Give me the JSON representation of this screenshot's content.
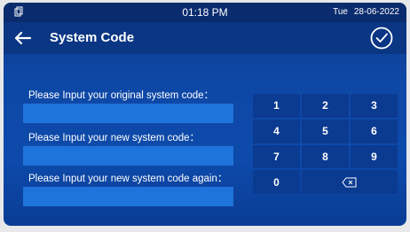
{
  "status": {
    "time": "01:18 PM",
    "day": "Tue",
    "date": "28-06-2022"
  },
  "header": {
    "title": "System Code"
  },
  "form": {
    "original_label": "Please Input your original system code：",
    "new_label": "Please Input your new system code：",
    "confirm_label": "Please Input your new system code again：",
    "original_value": "",
    "new_value": "",
    "confirm_value": ""
  },
  "keypad": {
    "keys": [
      "1",
      "2",
      "3",
      "4",
      "5",
      "6",
      "7",
      "8",
      "9",
      "0"
    ],
    "backspace_icon": "backspace-icon"
  },
  "colors": {
    "background": "#0d4aab",
    "status_bar": "#0a2c6e",
    "title_bar": "#0b3684",
    "input": "#1e74da",
    "key": "#0b3a91"
  }
}
